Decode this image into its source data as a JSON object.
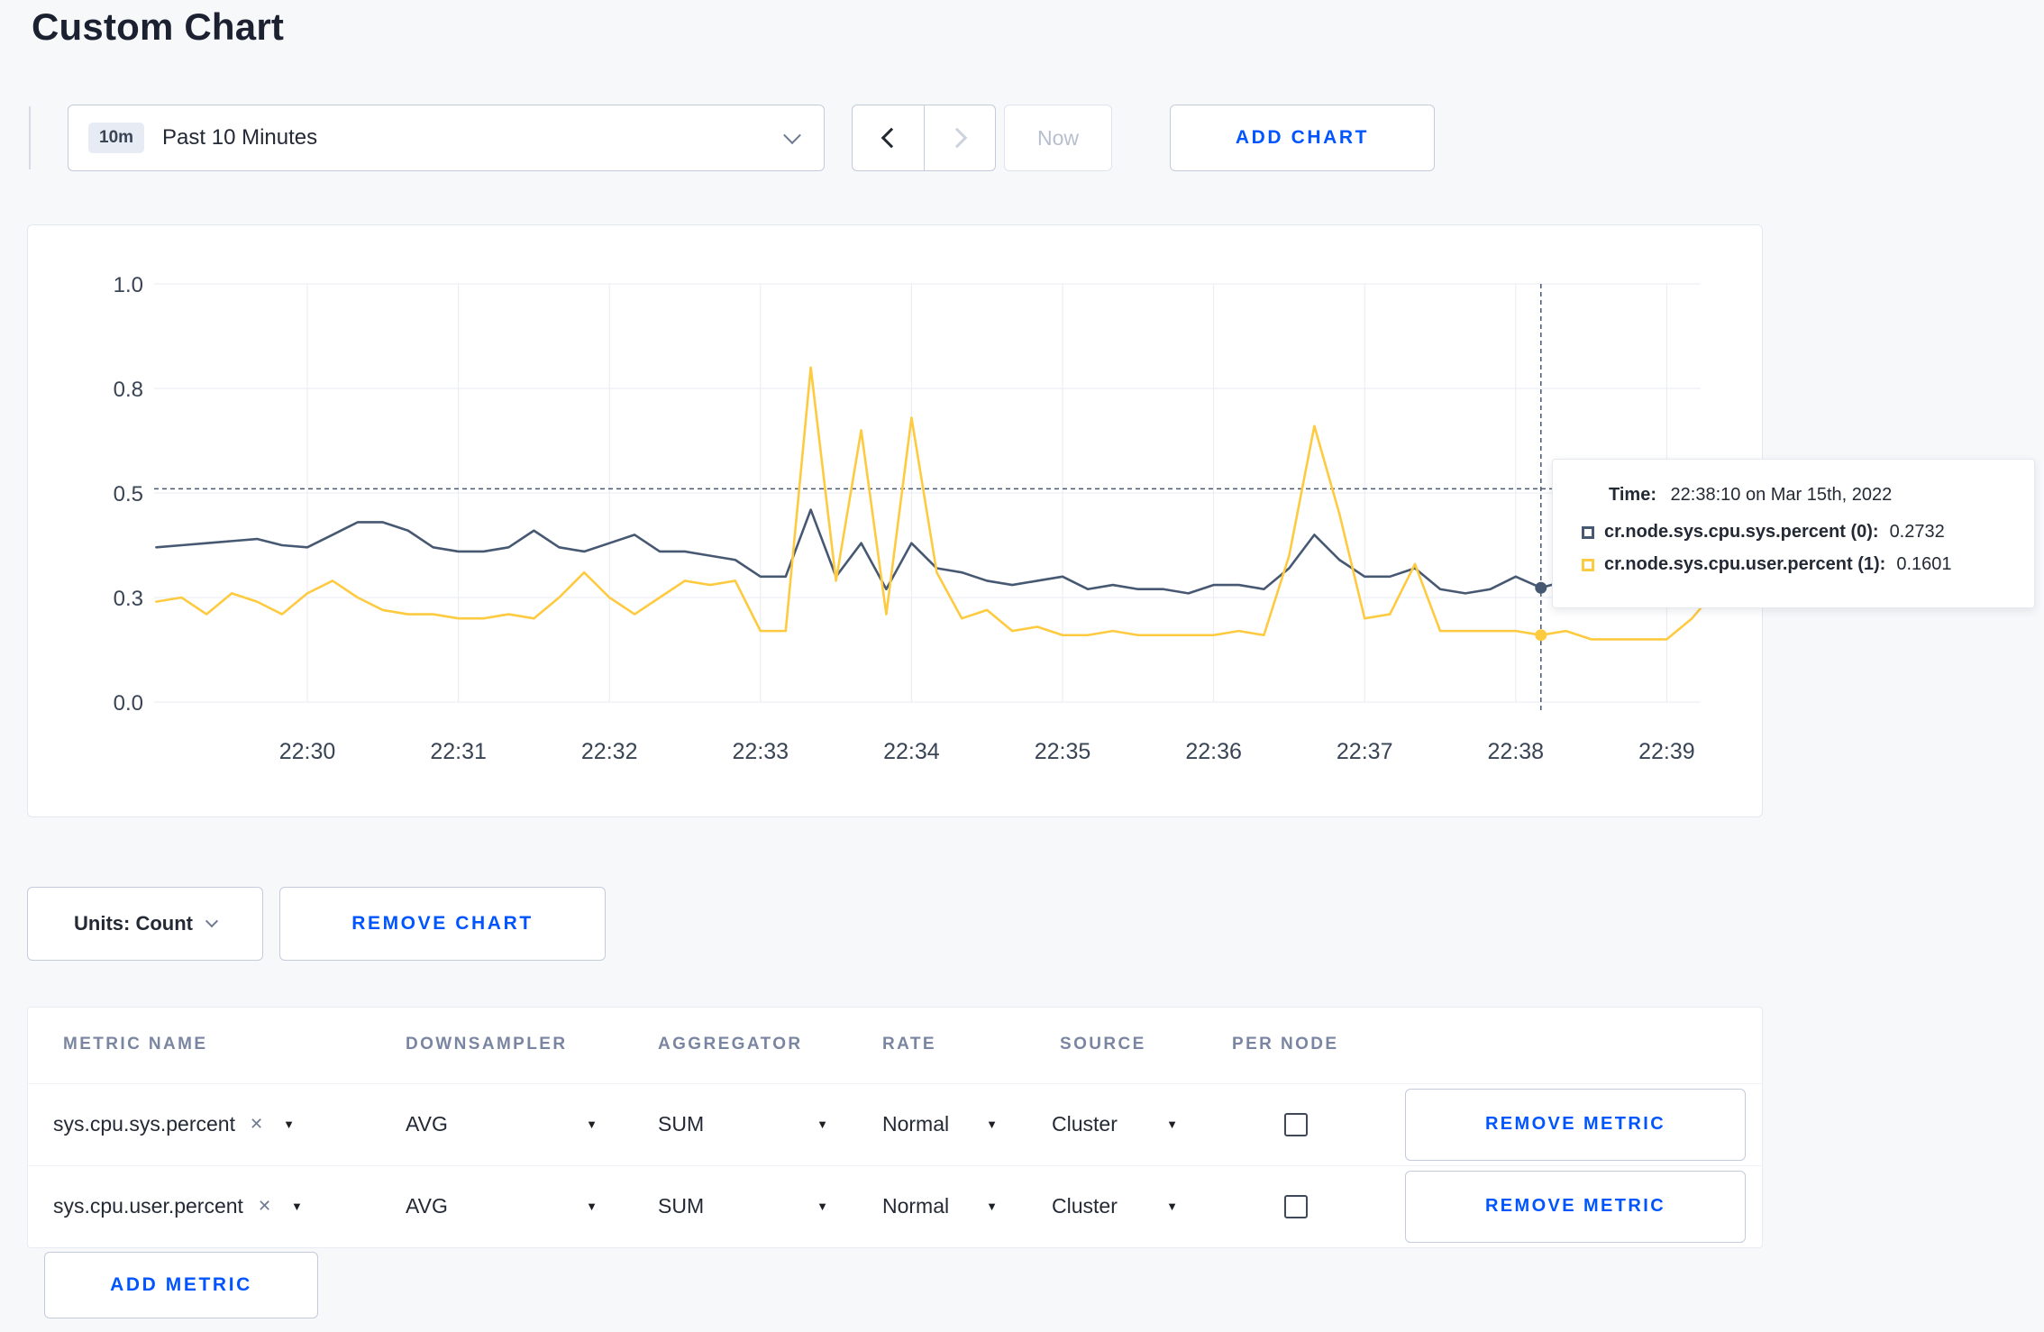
{
  "page": {
    "title": "Custom Chart"
  },
  "toolbar": {
    "time_range": {
      "badge": "10m",
      "label": "Past 10 Minutes"
    },
    "now_button": "Now",
    "add_chart_button": "ADD CHART"
  },
  "chart_data": {
    "type": "line",
    "title": "",
    "xlabel": "",
    "ylabel": "",
    "ylim": [
      0,
      1
    ],
    "x_tick_labels": [
      "22:30",
      "22:31",
      "22:32",
      "22:33",
      "22:34",
      "22:35",
      "22:36",
      "22:37",
      "22:38",
      "22:39"
    ],
    "y_tick_labels": [
      "0.0",
      "0.3",
      "0.5",
      "0.8",
      "1.0"
    ],
    "y_tick_values": [
      0,
      0.25,
      0.5,
      0.75,
      1.0
    ],
    "x": [
      29.0,
      29.167,
      29.333,
      29.5,
      29.667,
      29.833,
      30.0,
      30.167,
      30.333,
      30.5,
      30.667,
      30.833,
      31.0,
      31.167,
      31.333,
      31.5,
      31.667,
      31.833,
      32.0,
      32.167,
      32.333,
      32.5,
      32.667,
      32.833,
      33.0,
      33.167,
      33.333,
      33.5,
      33.667,
      33.833,
      34.0,
      34.167,
      34.333,
      34.5,
      34.667,
      34.833,
      35.0,
      35.167,
      35.333,
      35.5,
      35.667,
      35.833,
      36.0,
      36.167,
      36.333,
      36.5,
      36.667,
      36.833,
      37.0,
      37.167,
      37.333,
      37.5,
      37.667,
      37.833,
      38.0,
      38.167,
      38.333,
      38.5,
      38.667,
      38.833,
      39.0,
      39.167,
      39.333
    ],
    "series": [
      {
        "name": "cr.node.sys.cpu.sys.percent",
        "color": "#475872",
        "values": [
          0.37,
          0.375,
          0.38,
          0.385,
          0.39,
          0.375,
          0.37,
          0.4,
          0.43,
          0.43,
          0.41,
          0.37,
          0.36,
          0.36,
          0.37,
          0.41,
          0.37,
          0.36,
          0.38,
          0.4,
          0.36,
          0.36,
          0.35,
          0.34,
          0.3,
          0.3,
          0.46,
          0.3,
          0.38,
          0.27,
          0.38,
          0.32,
          0.31,
          0.29,
          0.28,
          0.29,
          0.3,
          0.27,
          0.28,
          0.27,
          0.27,
          0.26,
          0.28,
          0.28,
          0.27,
          0.32,
          0.4,
          0.34,
          0.3,
          0.3,
          0.32,
          0.27,
          0.26,
          0.27,
          0.3,
          0.2732,
          0.29,
          0.3,
          0.29,
          0.3,
          0.3,
          0.31,
          0.3
        ]
      },
      {
        "name": "cr.node.sys.cpu.user.percent",
        "color": "#fdca40",
        "values": [
          0.24,
          0.25,
          0.21,
          0.26,
          0.24,
          0.21,
          0.26,
          0.29,
          0.25,
          0.22,
          0.21,
          0.21,
          0.2,
          0.2,
          0.21,
          0.2,
          0.25,
          0.31,
          0.25,
          0.21,
          0.25,
          0.29,
          0.28,
          0.29,
          0.17,
          0.17,
          0.8,
          0.29,
          0.65,
          0.21,
          0.68,
          0.31,
          0.2,
          0.22,
          0.17,
          0.18,
          0.16,
          0.16,
          0.17,
          0.16,
          0.16,
          0.16,
          0.16,
          0.17,
          0.16,
          0.35,
          0.66,
          0.45,
          0.2,
          0.21,
          0.33,
          0.17,
          0.17,
          0.17,
          0.17,
          0.1601,
          0.17,
          0.15,
          0.15,
          0.15,
          0.15,
          0.2,
          0.27
        ]
      }
    ],
    "crosshair": {
      "t": 38.167,
      "hline_value": 0.51,
      "values": [
        0.2732,
        0.1601
      ]
    },
    "legend_position": "tooltip",
    "grid": true
  },
  "tooltip": {
    "time_label": "Time:",
    "time_value": "22:38:10 on Mar 15th, 2022",
    "series": [
      {
        "label": "cr.node.sys.cpu.sys.percent (0):",
        "value": "0.2732"
      },
      {
        "label": "cr.node.sys.cpu.user.percent (1):",
        "value": "0.1601"
      }
    ]
  },
  "units_bar": {
    "units_label": "Units: Count",
    "remove_chart_button": "REMOVE CHART"
  },
  "metrics_table": {
    "headers": [
      "METRIC NAME",
      "DOWNSAMPLER",
      "AGGREGATOR",
      "RATE",
      "SOURCE",
      "PER NODE"
    ],
    "rows": [
      {
        "metric": "sys.cpu.sys.percent",
        "downsampler": "AVG",
        "aggregator": "SUM",
        "rate": "Normal",
        "source": "Cluster",
        "per_node_checked": false,
        "remove_button": "REMOVE METRIC"
      },
      {
        "metric": "sys.cpu.user.percent",
        "downsampler": "AVG",
        "aggregator": "SUM",
        "rate": "Normal",
        "source": "Cluster",
        "per_node_checked": false,
        "remove_button": "REMOVE METRIC"
      }
    ],
    "add_metric_button": "ADD METRIC"
  }
}
